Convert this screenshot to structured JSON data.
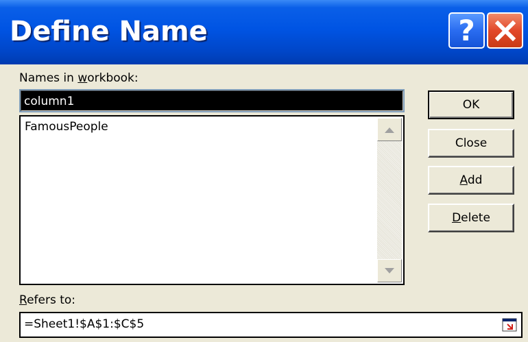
{
  "window": {
    "title": "Define Name",
    "help_label": "?",
    "close_label": "close"
  },
  "names_label": {
    "pre": "Names in ",
    "mnemonic": "w",
    "post": "orkbook:"
  },
  "name_input": {
    "value": "column1"
  },
  "names_list": {
    "items": [
      "FamousPeople"
    ]
  },
  "refers_label": {
    "mnemonic": "R",
    "post": "efers to:"
  },
  "refers_input": {
    "value": "=Sheet1!$A$1:$C$5"
  },
  "buttons": {
    "ok": "OK",
    "close": "Close",
    "add_mnemonic": "A",
    "add_rest": "dd",
    "delete_mnemonic": "D",
    "delete_rest": "elete"
  },
  "icons": {
    "help": "help-icon",
    "close": "close-icon",
    "scroll_up": "scroll-up-icon",
    "scroll_down": "scroll-down-icon",
    "collapse": "collapse-dialog-icon"
  },
  "colors": {
    "titlebar": "#0054e3",
    "close_button": "#e2492a",
    "dialog_bg": "#ece9d8"
  }
}
